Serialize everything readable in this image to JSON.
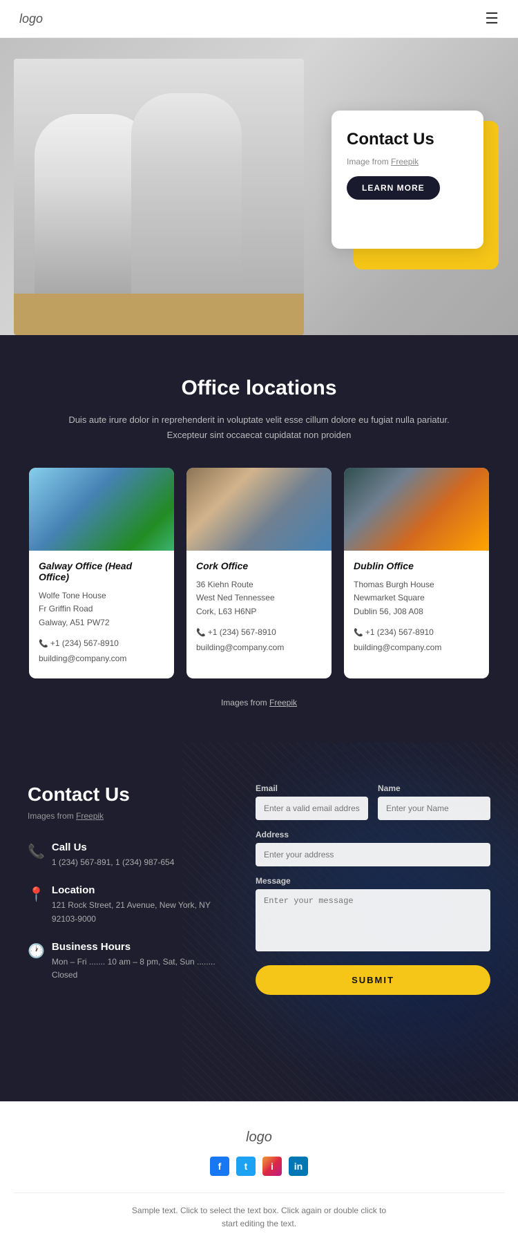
{
  "nav": {
    "logo": "logo",
    "hamburger_label": "☰"
  },
  "hero": {
    "card_title": "Contact Us",
    "freepik_text": "Image from",
    "freepik_link": "Freepik",
    "learn_more_btn": "LEARN MORE"
  },
  "office": {
    "section_title": "Office locations",
    "subtitle_line1": "Duis aute irure dolor in reprehenderit in voluptate velit esse cillum dolore eu fugiat nulla pariatur.",
    "subtitle_line2": "Excepteur sint occaecat cupidatat non proiden",
    "cards": [
      {
        "name": "Galway Office (Head Office)",
        "address_line1": "Wolfe Tone House",
        "address_line2": "Fr Griffin Road",
        "address_line3": "Galway, A51 PW72",
        "phone": "+1 (234) 567-8910",
        "email": "building@company.com"
      },
      {
        "name": "Cork Office",
        "address_line1": "36 Kiehn Route",
        "address_line2": "West Ned Tennessee",
        "address_line3": "Cork, L63 H6NP",
        "phone": "+1 (234) 567-8910",
        "email": "building@company.com"
      },
      {
        "name": "Dublin Office",
        "address_line1": "Thomas Burgh House",
        "address_line2": "Newmarket Square",
        "address_line3": "Dublin 56, J08 A08",
        "phone": "+1 (234) 567-8910",
        "email": "building@company.com"
      }
    ],
    "freepik_text": "Images from",
    "freepik_link": "Freepik"
  },
  "contact": {
    "title": "Contact Us",
    "freepik_text": "Images from",
    "freepik_link": "Freepik",
    "call_title": "Call Us",
    "call_numbers": "1 (234) 567-891, 1 (234) 987-654",
    "location_title": "Location",
    "location_address": "121 Rock Street, 21 Avenue, New York, NY 92103-9000",
    "hours_title": "Business Hours",
    "hours_text": "Mon – Fri ....... 10 am – 8 pm, Sat, Sun ........ Closed",
    "form": {
      "email_label": "Email",
      "email_placeholder": "Enter a valid email address",
      "name_label": "Name",
      "name_placeholder": "Enter your Name",
      "address_label": "Address",
      "address_placeholder": "Enter your address",
      "message_label": "Message",
      "message_placeholder": "Enter your message",
      "submit_btn": "SUBMIT"
    }
  },
  "footer": {
    "logo": "logo",
    "social": [
      {
        "platform": "facebook",
        "label": "f"
      },
      {
        "platform": "twitter",
        "label": "t"
      },
      {
        "platform": "instagram",
        "label": "i"
      },
      {
        "platform": "linkedin",
        "label": "in"
      }
    ],
    "sample_text": "Sample text. Click to select the text box. Click again or double click to",
    "sample_text2": "start editing the text."
  }
}
